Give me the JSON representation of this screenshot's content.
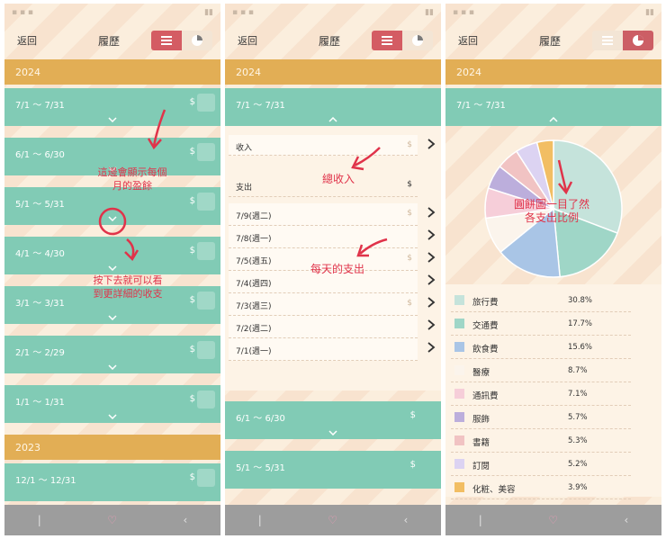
{
  "screens": [
    {
      "header": {
        "back": "返回",
        "title": "履歷"
      },
      "years": [
        "2024",
        "2023"
      ],
      "months_2024": [
        "7/1 ～ 7/31",
        "6/1 ～ 6/30",
        "5/1 ～ 5/31",
        "4/1 ～ 4/30",
        "3/1 ～ 3/31",
        "2/1 ～ 2/29",
        "1/1 ～ 1/31"
      ],
      "months_2023": [
        "12/1 ～ 12/31"
      ],
      "currency": "$",
      "annotations": [
        "這邊會顯示每個\n月的盈餘",
        "按下去就可以看\n到更詳細的收支"
      ]
    },
    {
      "header": {
        "back": "返回",
        "title": "履歷"
      },
      "year": "2024",
      "expanded_month": "7/1 ～ 7/31",
      "income_label": "收入",
      "expense_label": "支出",
      "currency": "$",
      "days": [
        "7/9(週二)",
        "7/8(週一)",
        "7/5(週五)",
        "7/4(週四)",
        "7/3(週三)",
        "7/2(週二)",
        "7/1(週一)"
      ],
      "more_months": [
        "6/1 ～ 6/30",
        "5/1 ～ 5/31"
      ],
      "annotations": [
        "總收入",
        "每天的支出"
      ]
    },
    {
      "header": {
        "back": "返回",
        "title": "履歷"
      },
      "year": "2024",
      "month": "7/1 ～ 7/31",
      "annotation": "圓餅圖一目了然\n各支出比例",
      "categories": [
        {
          "name": "旅行費",
          "percent": "30.8%",
          "value": 30.8,
          "color": "#c5e3db"
        },
        {
          "name": "交通費",
          "percent": "17.7%",
          "value": 17.7,
          "color": "#9fd6c7"
        },
        {
          "name": "飲食費",
          "percent": "15.6%",
          "value": 15.6,
          "color": "#a9c5e6"
        },
        {
          "name": "醫療",
          "percent": "8.7%",
          "value": 8.7,
          "color": "#fbf4ec"
        },
        {
          "name": "通訊費",
          "percent": "7.1%",
          "value": 7.1,
          "color": "#f6ced9"
        },
        {
          "name": "服飾",
          "percent": "5.7%",
          "value": 5.7,
          "color": "#bcaedc"
        },
        {
          "name": "書籍",
          "percent": "5.3%",
          "value": 5.3,
          "color": "#f1c3c3"
        },
        {
          "name": "訂閱",
          "percent": "5.2%",
          "value": 5.2,
          "color": "#dcd3f2"
        },
        {
          "name": "化粧、美容",
          "percent": "3.9%",
          "value": 3.9,
          "color": "#f2be63"
        }
      ]
    }
  ]
}
